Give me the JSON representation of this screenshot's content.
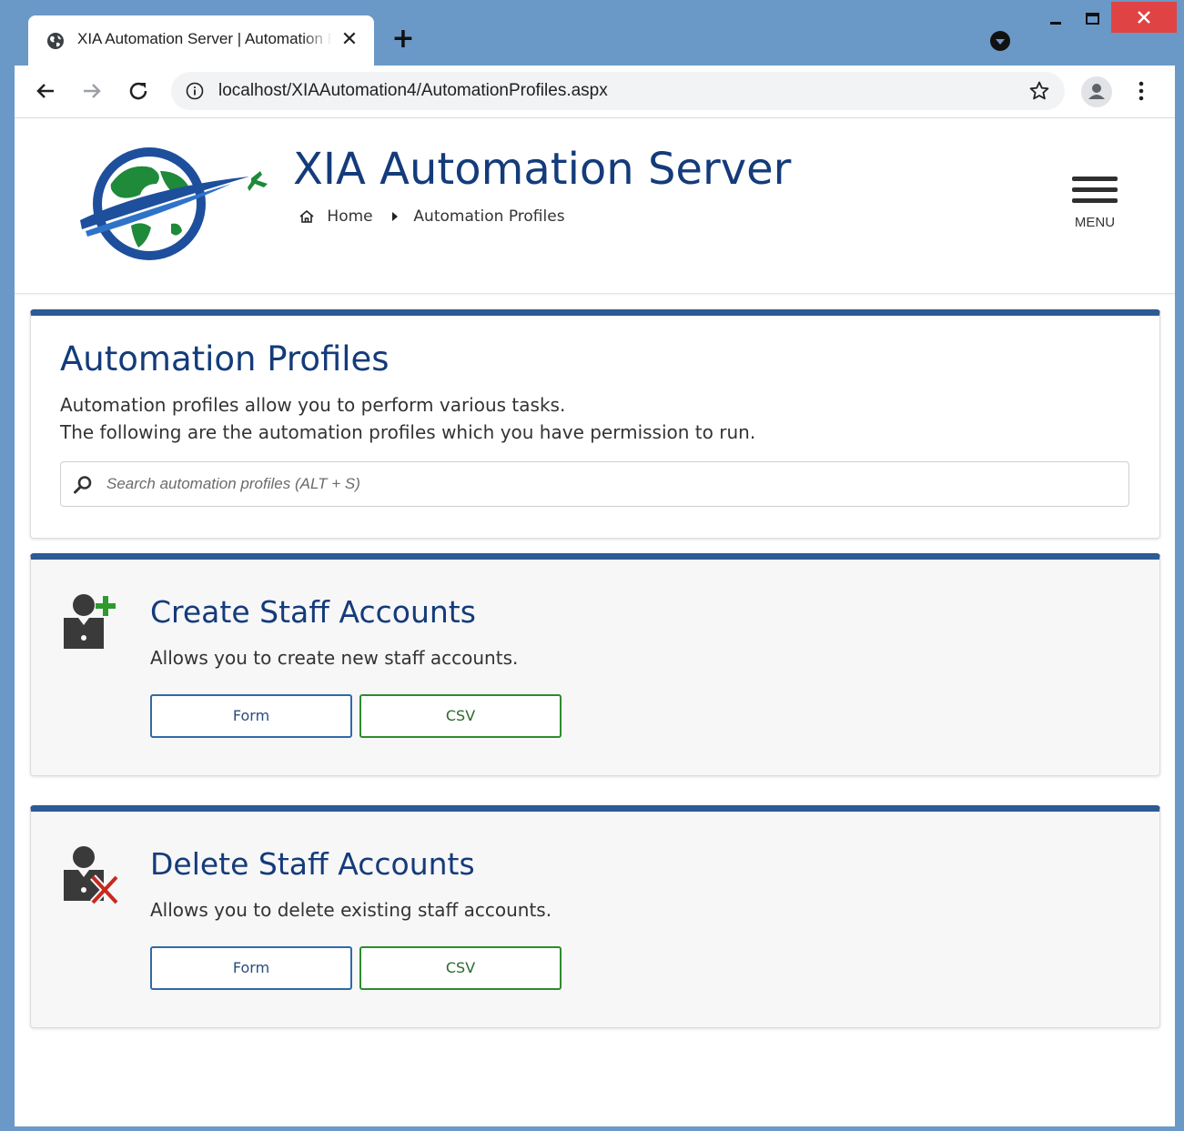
{
  "browser": {
    "tab_title": "XIA Automation Server | Automation Profiles",
    "tab_close": "✕",
    "new_tab": "+",
    "url": "localhost/XIAAutomation4/AutomationProfiles.aspx"
  },
  "header": {
    "site_title": "XIA Automation Server",
    "breadcrumb": {
      "home": "Home",
      "current": "Automation Profiles"
    },
    "menu_label": "MENU"
  },
  "intro": {
    "title": "Automation Profiles",
    "line1": "Automation profiles allow you to perform various tasks.",
    "line2": "The following are the automation profiles which you have permission to run.",
    "search_placeholder": "Search automation profiles (ALT + S)"
  },
  "profiles": [
    {
      "icon": "add-user-icon",
      "title": "Create Staff Accounts",
      "description": "Allows you to create new staff accounts.",
      "form_label": "Form",
      "csv_label": "CSV"
    },
    {
      "icon": "delete-user-icon",
      "title": "Delete Staff Accounts",
      "description": "Allows you to delete existing staff accounts.",
      "form_label": "Form",
      "csv_label": "CSV"
    }
  ],
  "colors": {
    "brand_blue": "#143b7a",
    "card_accent": "#2e5a95",
    "window_frame": "#6a99c8",
    "csv_green": "#2e8b2e"
  }
}
